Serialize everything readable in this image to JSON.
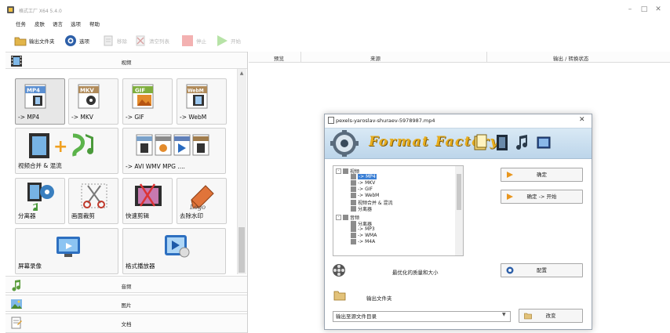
{
  "window": {
    "title": "格式工厂 X64 5.4.0"
  },
  "menu": [
    "任务",
    "皮肤",
    "语言",
    "选项",
    "帮助"
  ],
  "toolbar": {
    "output_folder": "输出文件夹",
    "options": "选项",
    "remove": "移除",
    "clear_list": "清空列表",
    "stop": "停止",
    "start": "开始"
  },
  "left": {
    "categories": {
      "video": "视频",
      "audio": "音频",
      "image": "图片",
      "document": "文档"
    },
    "video_tiles": [
      {
        "label": "-> MP4",
        "badge": "MP4"
      },
      {
        "label": "-> MKV",
        "badge": "MKV"
      },
      {
        "label": "-> GIF",
        "badge": "GIF"
      },
      {
        "label": "-> WebM",
        "badge": "WebM"
      },
      {
        "label": "视频合并 & 混流"
      },
      {
        "label": "-> AVI WMV MPG ...."
      },
      {
        "label": "分离器"
      },
      {
        "label": "画面裁剪"
      },
      {
        "label": "快速剪辑"
      },
      {
        "label": "去除水印"
      },
      {
        "label": "屏幕录像"
      },
      {
        "label": "格式播放器"
      }
    ]
  },
  "table_header": {
    "preview": "预览",
    "source": "来源",
    "output_status": "输出 / 转换状态"
  },
  "dialog": {
    "title": "pexels-yaroslav-shuraev-5978987.mp4",
    "banner_title": "Format Factory",
    "tree": [
      {
        "label": "视频",
        "level": 0,
        "expander": "-"
      },
      {
        "label": "-> MP4",
        "level": 1,
        "selected": true
      },
      {
        "label": "-> MKV",
        "level": 1
      },
      {
        "label": "-> GIF",
        "level": 1
      },
      {
        "label": "-> WebM",
        "level": 1
      },
      {
        "label": "视频合并 & 混流",
        "level": 1
      },
      {
        "label": "分离器",
        "level": 1
      },
      {
        "label": "音频",
        "level": 0,
        "expander": "-"
      },
      {
        "label": "分离器",
        "level": 1
      },
      {
        "label": "-> MP3",
        "level": 1
      },
      {
        "label": "-> WMA",
        "level": 1
      },
      {
        "label": "-> M4A",
        "level": 1
      }
    ],
    "ok_button": "确定",
    "ok_start_button": "确定 -> 开始",
    "optimize_label": "最优化的质量和大小",
    "config_button": "配置",
    "output_folder_label": "输出文件夹",
    "destination_value": "输出至源文件目录",
    "change_button": "改变"
  },
  "colors": {
    "accent_gold": "#e8ad1c",
    "banner_blue": "#bcd5ea",
    "selection": "#3a7fd5"
  }
}
